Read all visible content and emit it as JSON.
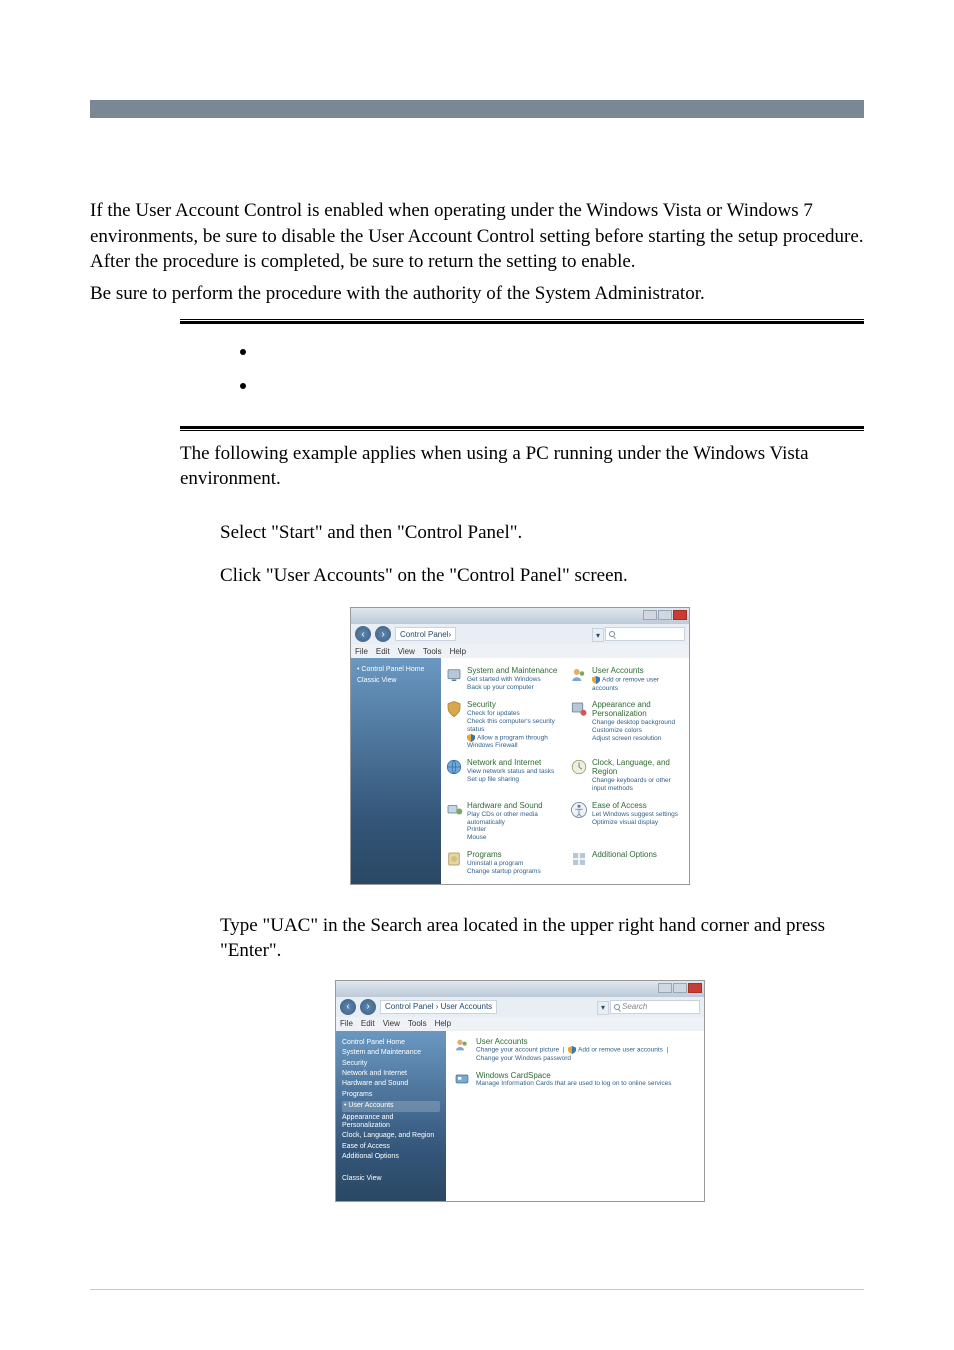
{
  "intro_paragraph": "If the User Account Control is enabled when operating under the Windows Vista or Windows 7 environments, be sure to disable the User Account Control setting before starting the setup procedure. After the procedure is completed, be sure to return the setting to enable.",
  "intro_line2": "Be sure to perform the procedure with the authority of the System Administrator.",
  "context_paragraph": "The following example applies when using a PC running under the Windows Vista environment.",
  "step1": "Select \"Start\" and then \"Control Panel\".",
  "step2": "Click \"User Accounts\" on the \"Control Panel\" screen.",
  "step3": "Type \"UAC\" in the Search area located in the upper right hand corner and press \"Enter\".",
  "cp": {
    "breadcrumb": "Control Panel",
    "menu": [
      "File",
      "Edit",
      "View",
      "Tools",
      "Help"
    ],
    "sidebar": {
      "home": "Control Panel Home",
      "classic": "Classic View"
    },
    "categories": {
      "system": {
        "title": "System and Maintenance",
        "sub1": "Get started with Windows",
        "sub2": "Back up your computer"
      },
      "security": {
        "title": "Security",
        "sub1": "Check for updates",
        "sub2": "Check this computer's security status",
        "sub3": "Allow a program through Windows Firewall"
      },
      "network": {
        "title": "Network and Internet",
        "sub1": "View network status and tasks",
        "sub2": "Set up file sharing"
      },
      "hardware": {
        "title": "Hardware and Sound",
        "sub1": "Play CDs or other media automatically",
        "sub2": "Printer",
        "sub3": "Mouse"
      },
      "programs": {
        "title": "Programs",
        "sub1": "Uninstall a program",
        "sub2": "Change startup programs"
      },
      "users": {
        "title": "User Accounts",
        "sub1": "Add or remove user accounts"
      },
      "appearance": {
        "title": "Appearance and Personalization",
        "sub1": "Change desktop background",
        "sub2": "Customize colors",
        "sub3": "Adjust screen resolution"
      },
      "clock": {
        "title": "Clock, Language, and Region",
        "sub1": "Change keyboards or other input methods"
      },
      "ease": {
        "title": "Ease of Access",
        "sub1": "Let Windows suggest settings",
        "sub2": "Optimize visual display"
      },
      "additional": {
        "title": "Additional Options"
      }
    }
  },
  "ua": {
    "breadcrumb": "Control Panel  ›  User Accounts",
    "search_value": "Search",
    "menu": [
      "File",
      "Edit",
      "View",
      "Tools",
      "Help"
    ],
    "sidebar": [
      "Control Panel Home",
      "System and Maintenance",
      "Security",
      "Network and Internet",
      "Hardware and Sound",
      "Programs",
      "User Accounts",
      "Appearance and Personalization",
      "Clock, Language, and Region",
      "Ease of Access",
      "Additional Options",
      "Classic View"
    ],
    "res1": {
      "title": "User Accounts",
      "link1": "Change your account picture",
      "link2": "Add or remove user accounts",
      "link3": "Change your Windows password"
    },
    "res2": {
      "title": "Windows CardSpace",
      "body": "Manage Information Cards that are used to log on to online services"
    }
  }
}
